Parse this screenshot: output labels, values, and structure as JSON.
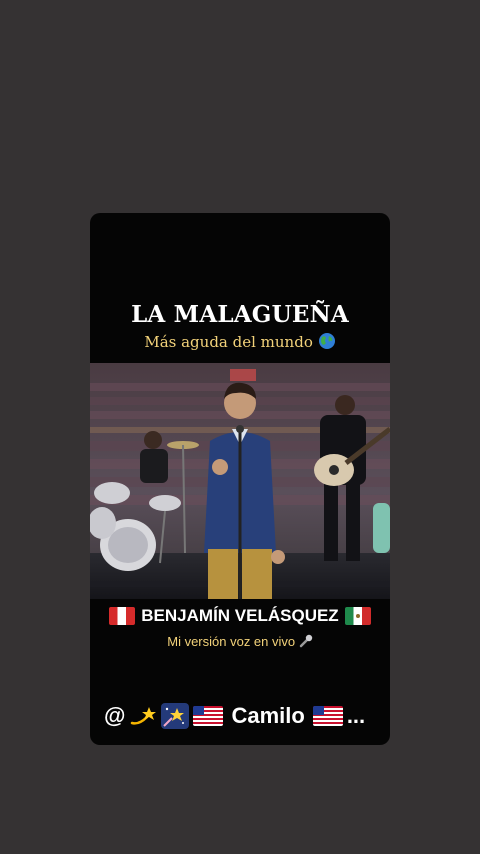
{
  "story": {
    "title": "LA MALAGUEÑA",
    "subtitle": "Más aguda del mundo",
    "subtitle_icon": "globe-icon",
    "artist": "BENJAMÍN VELÁSQUEZ",
    "artist_flags": [
      "peru-flag",
      "mexico-flag"
    ],
    "tagline": "Mi versión voz en vivo",
    "tagline_icon": "microphone-icon"
  },
  "user": {
    "prefix": "@",
    "name": "Camilo",
    "ellipsis": "...",
    "icons": [
      "dizzy-star-icon",
      "shooting-star-icon",
      "us-flag",
      "us-flag"
    ]
  },
  "colors": {
    "background": "#353233",
    "card": "#050505",
    "accent_text": "#f2d27a"
  }
}
